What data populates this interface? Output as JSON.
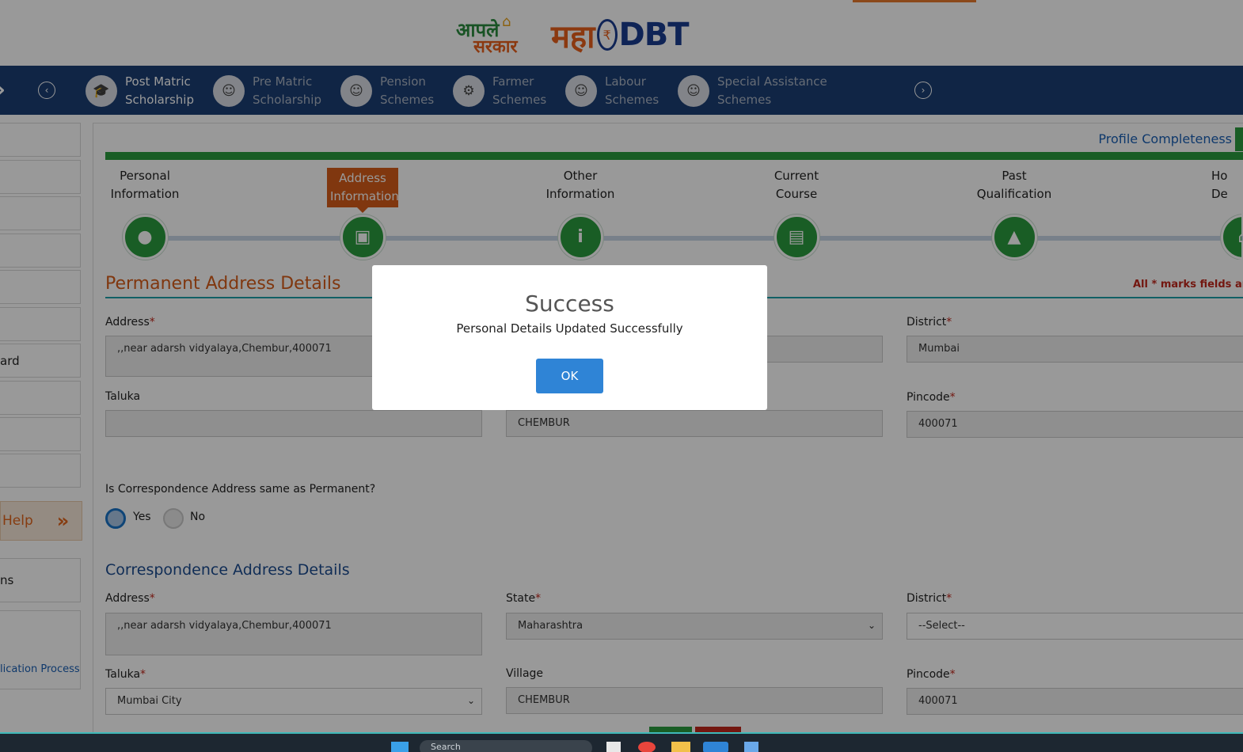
{
  "header": {
    "logo_aaple_line1": "आपले",
    "logo_aaple_line2": "सरकार",
    "logo_maha": "महा",
    "logo_rupee": "₹",
    "logo_dbt": "DBT"
  },
  "nav": {
    "items": [
      {
        "line1": "Post Matric",
        "line2": "Scholarship",
        "icon": "graduation-icon"
      },
      {
        "line1": "Pre Matric",
        "line2": "Scholarship",
        "icon": "student-icon"
      },
      {
        "line1": "Pension",
        "line2": "Schemes",
        "icon": "elderly-icon"
      },
      {
        "line1": "Farmer",
        "line2": "Schemes",
        "icon": "tractor-icon"
      },
      {
        "line1": "Labour",
        "line2": "Schemes",
        "icon": "worker-icon"
      },
      {
        "line1": "Special Assistance",
        "line2": "Schemes",
        "icon": "assistance-icon"
      }
    ],
    "prev": "‹",
    "next": "›"
  },
  "sidebar": {
    "item_partial_board": "ard",
    "help": "Help",
    "help_arrow": "»",
    "item_partial_ns": "ns",
    "link_partial": "lication Process"
  },
  "profile": {
    "label": "Profile Completeness"
  },
  "steps": [
    {
      "line1": "Personal",
      "line2": "Information",
      "icon": "user-icon",
      "glyph": "👤"
    },
    {
      "line1": "Address",
      "line2": "Information",
      "icon": "address-book-icon",
      "glyph": "▣",
      "active": true
    },
    {
      "line1": "Other",
      "line2": "Information",
      "icon": "info-icon",
      "glyph": "i"
    },
    {
      "line1": "Current",
      "line2": "Course",
      "icon": "book-icon",
      "glyph": "▤"
    },
    {
      "line1": "Past",
      "line2": "Qualification",
      "icon": "graduation-cap-icon",
      "glyph": "🎓"
    },
    {
      "line1": "Ho",
      "line2": "De",
      "icon": "home-icon",
      "glyph": "⌂"
    }
  ],
  "permanent": {
    "title": "Permanent Address Details",
    "mandatory_note": "All * marks fields are ma",
    "address_label": "Address",
    "address_value": ",,near adarsh vidyalaya,Chembur,400071",
    "district_label": "District",
    "district_value": "Mumbai",
    "taluka_label": "Taluka",
    "taluka_value": "",
    "village_value": "CHEMBUR",
    "pincode_label": "Pincode",
    "pincode_value": "400071",
    "req": "*"
  },
  "question": {
    "text": "Is Correspondence Address same as Permanent?",
    "yes": "Yes",
    "no": "No"
  },
  "correspondence": {
    "title": "Correspondence Address Details",
    "address_label": "Address",
    "address_value": ",,near adarsh vidyalaya,Chembur,400071",
    "state_label": "State",
    "state_value": "Maharashtra",
    "district_label": "District",
    "district_value": "--Select--",
    "taluka_label": "Taluka",
    "taluka_value": "Mumbai City",
    "village_label": "Village",
    "village_value": "CHEMBUR",
    "pincode_label": "Pincode",
    "pincode_value": "400071",
    "req": "*"
  },
  "dialog": {
    "title": "Success",
    "message": "Personal Details Updated Successfully",
    "ok": "OK"
  },
  "taskbar": {
    "search": "Search"
  },
  "colors": {
    "nav": "#1c3f74",
    "green": "#2a9b3e",
    "orange": "#d55c1a",
    "ok_button": "#2f84d6"
  }
}
